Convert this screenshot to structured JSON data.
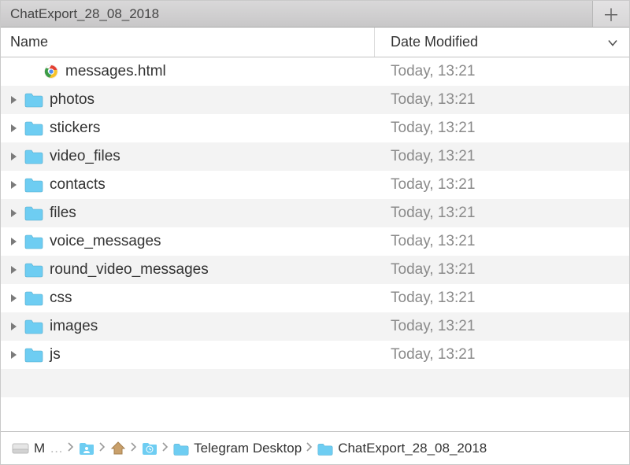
{
  "tab": {
    "title": "ChatExport_28_08_2018"
  },
  "columns": {
    "name": "Name",
    "date": "Date Modified"
  },
  "items": [
    {
      "type": "file",
      "name": "messages.html",
      "modified": "Today, 13:21"
    },
    {
      "type": "folder",
      "name": "photos",
      "modified": "Today, 13:21"
    },
    {
      "type": "folder",
      "name": "stickers",
      "modified": "Today, 13:21"
    },
    {
      "type": "folder",
      "name": "video_files",
      "modified": "Today, 13:21"
    },
    {
      "type": "folder",
      "name": "contacts",
      "modified": "Today, 13:21"
    },
    {
      "type": "folder",
      "name": "files",
      "modified": "Today, 13:21"
    },
    {
      "type": "folder",
      "name": "voice_messages",
      "modified": "Today, 13:21"
    },
    {
      "type": "folder",
      "name": "round_video_messages",
      "modified": "Today, 13:21"
    },
    {
      "type": "folder",
      "name": "css",
      "modified": "Today, 13:21"
    },
    {
      "type": "folder",
      "name": "images",
      "modified": "Today, 13:21"
    },
    {
      "type": "folder",
      "name": "js",
      "modified": "Today, 13:21"
    }
  ],
  "path": [
    {
      "icon": "drive",
      "label": "M"
    },
    {
      "icon": "users",
      "label": ""
    },
    {
      "icon": "home",
      "label": ""
    },
    {
      "icon": "clock",
      "label": ""
    },
    {
      "icon": "folder",
      "label": "Telegram Desktop"
    },
    {
      "icon": "folder",
      "label": "ChatExport_28_08_2018"
    }
  ],
  "colors": {
    "folder": "#6ecdf2"
  }
}
